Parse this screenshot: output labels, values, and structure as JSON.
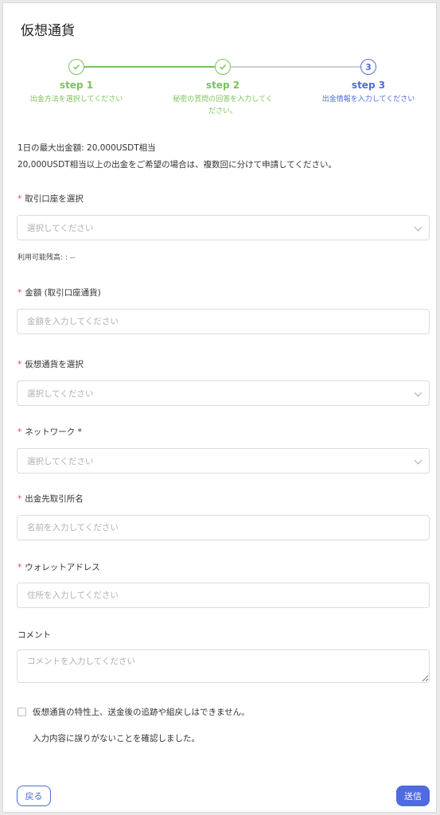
{
  "page": {
    "title": "仮想通貨"
  },
  "steps": [
    {
      "number": "1",
      "name": "step 1",
      "desc": "出金方法を選択してください",
      "state": "done"
    },
    {
      "number": "2",
      "name": "step 2",
      "desc": "秘密の質問の回答を入力してください。",
      "state": "done"
    },
    {
      "number": "3",
      "name": "step 3",
      "desc": "出金情報を入力してください",
      "state": "active"
    }
  ],
  "info": {
    "line1": "1日の最大出金額: 20,000USDT相当",
    "line2": "20,000USDT相当以上の出金をご希望の場合は、複数回に分けて申請してください。"
  },
  "form": {
    "account": {
      "label": "取引口座を選択",
      "placeholder": "選択してください",
      "balance": "利用可能残高: : --"
    },
    "amount": {
      "label": "金額 (取引口座通貨)",
      "placeholder": "金額を入力してください"
    },
    "crypto": {
      "label": "仮想通貨を選択",
      "placeholder": "選択してください"
    },
    "network": {
      "label": "ネットワーク *",
      "placeholder": "選択してください"
    },
    "exchange": {
      "label": "出金先取引所名",
      "placeholder": "名前を入力してください"
    },
    "wallet": {
      "label": "ウォレットアドレス",
      "placeholder": "住所を入力してください"
    },
    "comment": {
      "label": "コメント",
      "placeholder": "コメントを入力してください"
    },
    "required_mark": "*"
  },
  "agreement": {
    "line1": "仮想通貨の特性上、送金後の追跡や組戻しはできません。",
    "line2": "入力内容に誤りがないことを確認しました。"
  },
  "buttons": {
    "back": "戻る",
    "submit": "送信"
  },
  "colors": {
    "accent": "#4f6be0",
    "done": "#7cc35a",
    "required": "#e04b4b"
  }
}
